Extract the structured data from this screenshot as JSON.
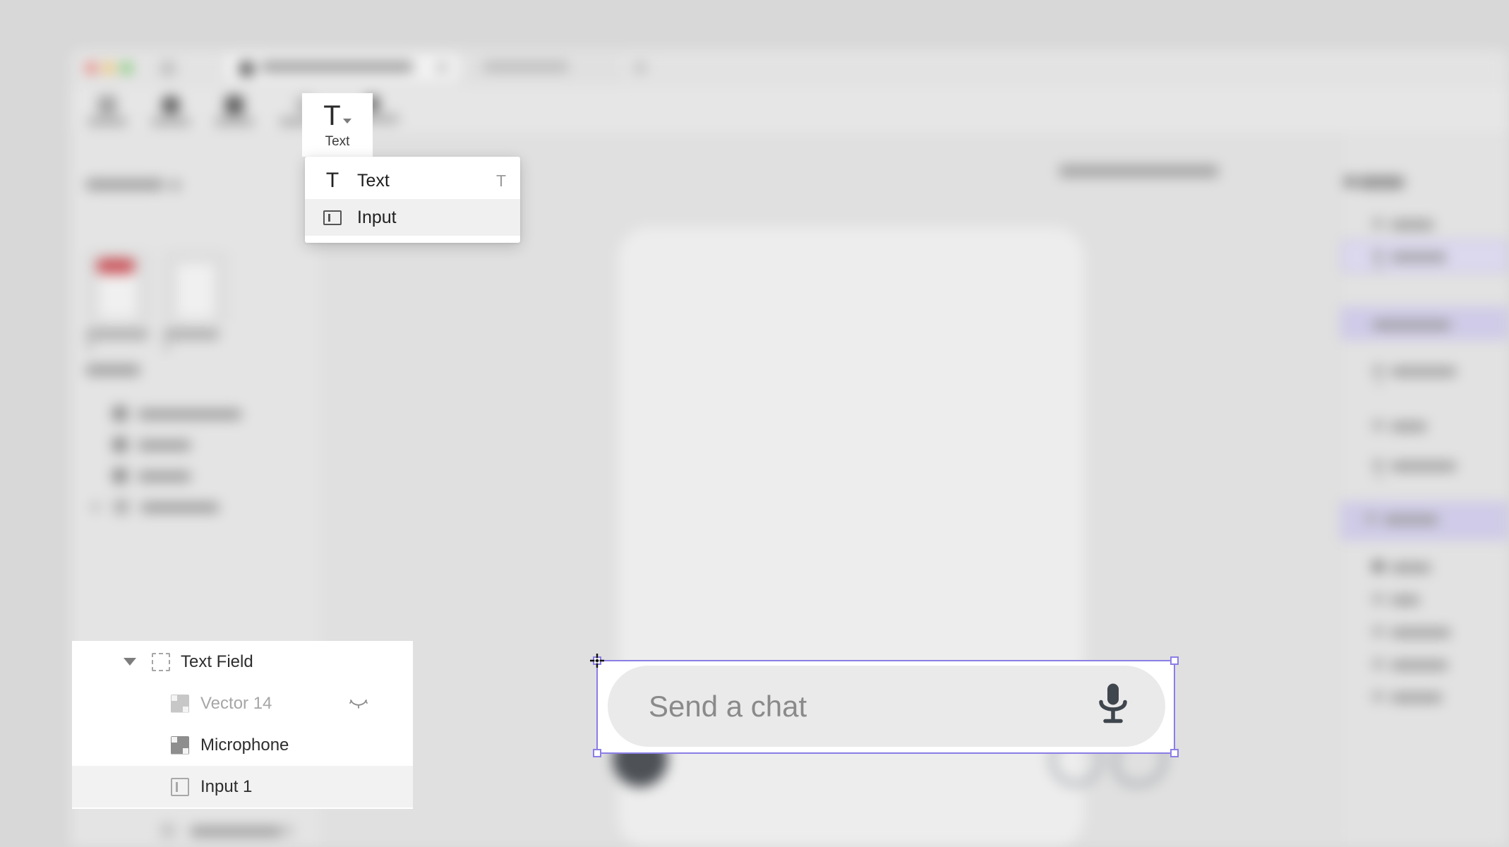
{
  "app": {
    "window_controls": [
      "close",
      "minimize",
      "maximize"
    ]
  },
  "toolbar": {
    "text_tool": {
      "icon": "text-T-icon",
      "label": "Text",
      "has_dropdown": true,
      "active": true
    }
  },
  "dropdown": {
    "items": [
      {
        "icon": "text-T-icon",
        "label": "Text",
        "shortcut": "T",
        "selected": false
      },
      {
        "icon": "input-field-icon",
        "label": "Input",
        "shortcut": "",
        "selected": true
      }
    ]
  },
  "layers_panel": {
    "rows": [
      {
        "label": "Text Field",
        "icon": "frame-icon",
        "indent": 0,
        "expanded": true,
        "selected": false,
        "muted": false,
        "hidden_toggle": false
      },
      {
        "label": "Vector 14",
        "icon": "vector-icon",
        "indent": 1,
        "expanded": false,
        "selected": false,
        "muted": true,
        "hidden_toggle": true
      },
      {
        "label": "Microphone",
        "icon": "vector-icon",
        "indent": 1,
        "expanded": false,
        "selected": false,
        "muted": false,
        "hidden_toggle": false
      },
      {
        "label": "Input 1",
        "icon": "input-field-icon",
        "indent": 1,
        "expanded": false,
        "selected": true,
        "muted": false,
        "hidden_toggle": false
      }
    ]
  },
  "canvas": {
    "selected_element": {
      "type": "input",
      "placeholder": "Send a chat",
      "trailing_icon": "microphone-icon",
      "selection_color": "#8a7ee6",
      "handles": 4
    }
  },
  "colors": {
    "selection": "#8a7ee6",
    "canvas_bg": "#e0e0e0",
    "panel_bg": "#e4e4e4",
    "pill_bg": "#eaeaea",
    "placeholder_text": "#8a8a8a",
    "mic_icon": "#3f464d",
    "badge_red": "#c9545a",
    "menu_highlight": "#f0f0f0"
  }
}
